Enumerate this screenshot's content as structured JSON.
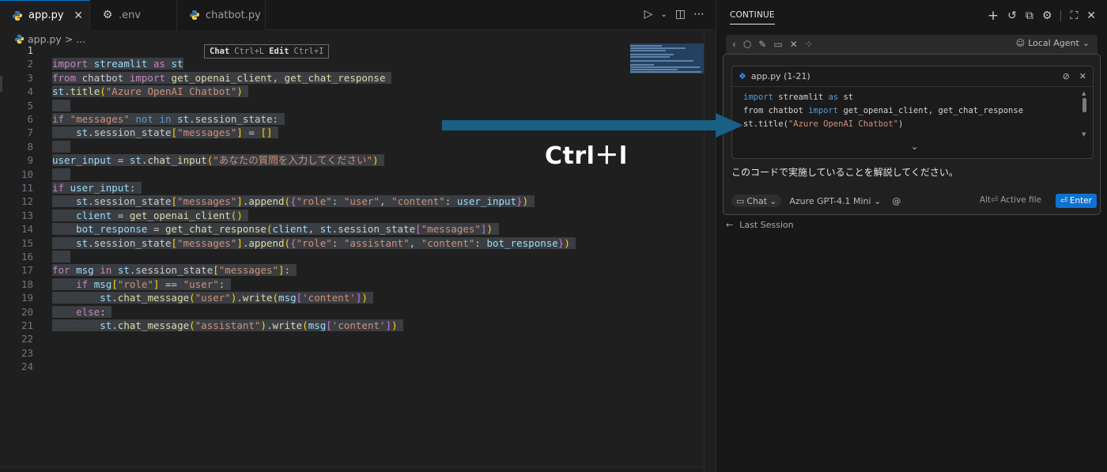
{
  "editor": {
    "tabs": [
      {
        "label": "app.py",
        "icon": "python-icon",
        "active": true
      },
      {
        "label": ".env",
        "icon": "gear-icon",
        "active": false
      },
      {
        "label": "chatbot.py",
        "icon": "python-icon",
        "active": false
      }
    ],
    "breadcrumb": {
      "file": "app.py",
      "sep": ">",
      "rest": "..."
    },
    "hint": {
      "chat_label": "Chat",
      "chat_key": "Ctrl+L",
      "edit_label": "Edit",
      "edit_key": "Ctrl+I"
    },
    "line_numbers": [
      "1",
      "2",
      "3",
      "4",
      "5",
      "6",
      "7",
      "8",
      "9",
      "10",
      "11",
      "12",
      "13",
      "14",
      "15",
      "16",
      "17",
      "18",
      "19",
      "20",
      "21",
      "22",
      "23",
      "24"
    ]
  },
  "panel": {
    "title": "CONTINUE",
    "agent_mode": "Local Agent",
    "context_file": "app.py (1-21)",
    "context_lines": [
      "import streamlit as st",
      "from chatbot import get_openai_client, get_chat_response",
      "st.title(\"Azure OpenAI Chatbot\")"
    ],
    "question": "このコードで実施していることを解説してください。",
    "mode": "Chat",
    "model": "Azure GPT-4.1 Mini",
    "at_symbol": "@",
    "active_file_hint": "Alt⏎ Active file",
    "enter_label": "Enter",
    "last_session": "Last Session"
  },
  "annotation": {
    "shortcut_text": "Ctrl＋l",
    "arrow_color": "#1a5f86"
  },
  "colors": {
    "accent": "#0078d4",
    "enter_button": "#0e72d1",
    "keyword": "#c586c0",
    "string": "#ce9178"
  }
}
